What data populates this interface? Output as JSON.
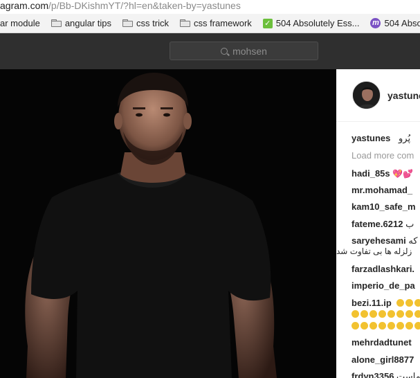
{
  "browser": {
    "url_prefix": "agram.com",
    "url_path": "/p/Bb-DKishmYT/?hl=en&taken-by=yastunes",
    "bookmarks": [
      {
        "label": "ar module",
        "icon": "none"
      },
      {
        "label": "angular tips",
        "icon": "folder-icon"
      },
      {
        "label": "css trick",
        "icon": "folder-icon"
      },
      {
        "label": "css framework",
        "icon": "folder-icon"
      },
      {
        "label": "504 Absolutely Ess...",
        "icon": "checkmark-icon"
      },
      {
        "label": "504 Absolu",
        "icon": "m-circle-icon"
      }
    ]
  },
  "header": {
    "search_value": "mohsen"
  },
  "post": {
    "owner": "yastunes",
    "caption_user": "yastunes",
    "caption_text": "پُرو",
    "load_more": "Load more com",
    "comments": [
      {
        "user": "hadi_85s",
        "text": ""
      },
      {
        "user": "mr.mohamad_",
        "text": ""
      },
      {
        "user": "kam10_safe_m",
        "text": ""
      },
      {
        "user": "fateme.6212",
        "text": "ب"
      },
      {
        "user": "saryehesami",
        "text": "که",
        "line2": "زلزله ها بی تفاوت شد"
      },
      {
        "user": "farzadlashkari.",
        "text": ""
      },
      {
        "user": "imperio_de_pa",
        "text": ""
      },
      {
        "user": "bezi.11.ip",
        "text": ""
      },
      {
        "user": "mehrdadtunet",
        "text": ""
      },
      {
        "user": "alone_girl8877",
        "text": ""
      },
      {
        "user": "frdyn3356",
        "text": "ماست"
      }
    ]
  },
  "colors": {
    "header_bg": "#2f2f2f",
    "photo_bg": "#050505",
    "username": "#262626",
    "muted": "#999999"
  }
}
